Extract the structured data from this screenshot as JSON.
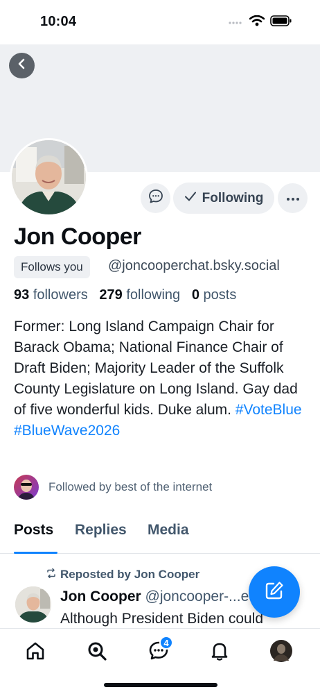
{
  "status_bar": {
    "time": "10:04"
  },
  "profile": {
    "name": "Jon Cooper",
    "follows_you_label": "Follows you",
    "handle": "@joncooperchat.bsky.social",
    "following_button_label": "Following",
    "stats": {
      "followers_count": "93",
      "followers_label": "followers",
      "following_count": "279",
      "following_label": "following",
      "posts_count": "0",
      "posts_label": "posts"
    },
    "bio_text": "Former: Long Island Campaign Chair for Barack Obama; National Finance Chair of Draft Biden; Majority Leader of the Suffolk County Legislature on Long Island. Gay dad of five wonderful kids. Duke alum.",
    "bio_tags": [
      "#VoteBlue",
      "#BlueWave2026"
    ],
    "followed_by_text": "Followed by best of the internet"
  },
  "tabs": [
    {
      "label": "Posts",
      "active": true
    },
    {
      "label": "Replies",
      "active": false
    },
    {
      "label": "Media",
      "active": false
    }
  ],
  "feed": {
    "repost_label": "Reposted by Jon Cooper",
    "post_author_name": "Jon Cooper",
    "post_author_handle": "@joncooper-...ed",
    "post_text": "Although President Biden could"
  },
  "bottom_nav": {
    "items": [
      "home-icon",
      "search-icon",
      "chat-icon",
      "bell-icon",
      "profile-avatar"
    ],
    "chat_badge": "4"
  },
  "colors": {
    "accent": "#1083fe",
    "text": "#0b0f14",
    "muted": "#42576c"
  }
}
